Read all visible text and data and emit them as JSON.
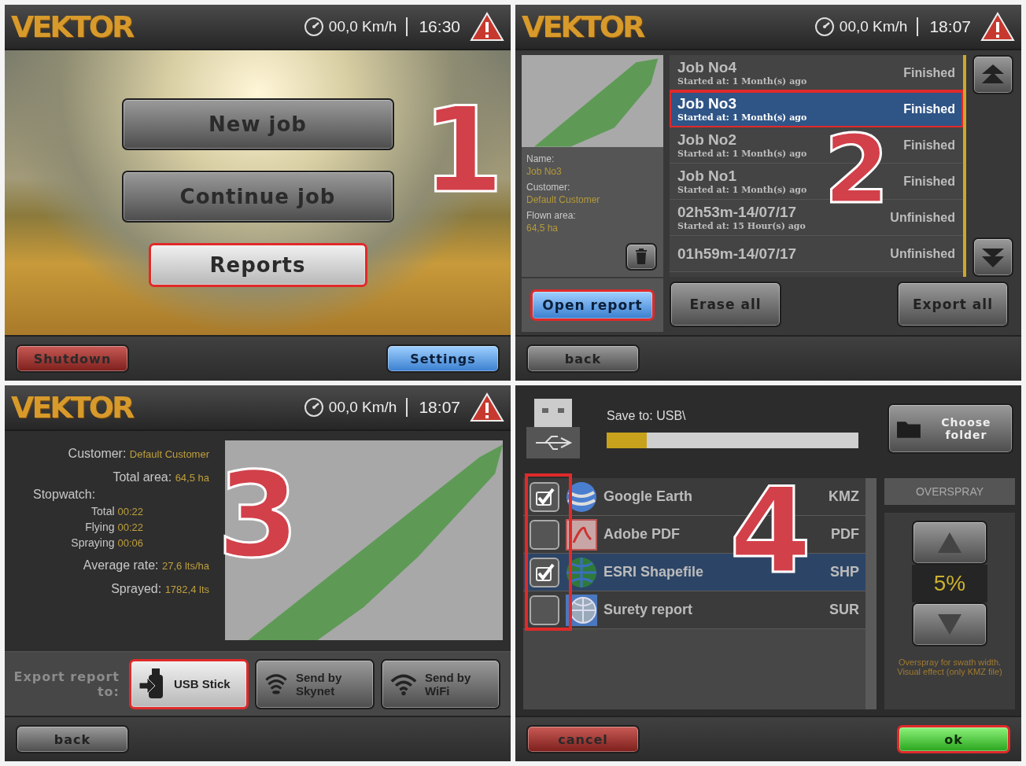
{
  "home": {
    "header": {
      "logo": "VEKTOR",
      "speed": "00,0 Km/h",
      "time": "16:30"
    },
    "step": "1",
    "buttons": [
      {
        "label": "New job",
        "highlighted": false
      },
      {
        "label": "Continue job",
        "highlighted": false
      },
      {
        "label": "Reports",
        "highlighted": true
      }
    ],
    "footer": [
      {
        "label": "Shutdown",
        "kind": "danger"
      },
      {
        "label": "Settings",
        "kind": "primary"
      }
    ]
  },
  "job_list": {
    "header": {
      "logo": "VEKTOR",
      "speed": "00,0 Km/h",
      "time": "18:07"
    },
    "step": "2",
    "details": [
      {
        "label": "Name:",
        "value": "Job No3"
      },
      {
        "label": "Customer:",
        "value": "Default Customer"
      },
      {
        "label": "Flown area:",
        "value": "64,5 ha"
      }
    ],
    "jobs": [
      {
        "name": "Job No4",
        "started": "Started at: 1 Month(s) ago",
        "status": "Finished",
        "selected": false,
        "highlighted": false
      },
      {
        "name": "Job No3",
        "started": "Started at: 1 Month(s) ago",
        "status": "Finished",
        "selected": true,
        "highlighted": true
      },
      {
        "name": "Job No2",
        "started": "Started at: 1 Month(s) ago",
        "status": "Finished",
        "selected": false,
        "highlighted": false
      },
      {
        "name": "Job No1",
        "started": "Started at: 1 Month(s) ago",
        "status": "Finished",
        "selected": false,
        "highlighted": false
      },
      {
        "name": "02h53m-14/07/17",
        "started": "Started at: 15 Hour(s) ago",
        "status": "Unfinished",
        "selected": false,
        "highlighted": false
      },
      {
        "name": "01h59m-14/07/17",
        "status": "Unfinished",
        "selected": false,
        "highlighted": false
      }
    ],
    "actions": [
      {
        "label": "Open report",
        "kind": "primary",
        "highlighted": true
      },
      {
        "label": "Erase all",
        "kind": "default",
        "highlighted": false
      },
      {
        "label": "Export all",
        "kind": "default",
        "highlighted": false
      }
    ],
    "footer": [
      {
        "label": "back",
        "kind": "default"
      }
    ]
  },
  "report": {
    "header": {
      "logo": "VEKTOR",
      "speed": "00,0 Km/h",
      "time": "18:07"
    },
    "step": "3",
    "summary": [
      {
        "kind": "main",
        "label": "Customer:",
        "value": "Default Customer"
      },
      {
        "kind": "main",
        "label": "Total area:",
        "value": "64,5 ha"
      },
      {
        "kind": "heading",
        "label": "Stopwatch:"
      },
      {
        "kind": "sub",
        "label": "Total",
        "value": "00:22"
      },
      {
        "kind": "sub",
        "label": "Flying",
        "value": "00:22"
      },
      {
        "kind": "sub",
        "label": "Spraying",
        "value": "00:06"
      },
      {
        "kind": "main",
        "label": "Average rate:",
        "value": "27,6 lts/ha"
      },
      {
        "kind": "main",
        "label": "Sprayed:",
        "value": "1782,4 lts"
      }
    ],
    "export_label": "Export report to:",
    "targets": [
      {
        "kind": "usb",
        "label": "USB Stick",
        "selected": true,
        "highlighted": true
      },
      {
        "kind": "skynet",
        "label": "Send by Skynet",
        "selected": false,
        "highlighted": false
      },
      {
        "kind": "wifi",
        "label": "Send by WiFi",
        "selected": false,
        "highlighted": false
      }
    ],
    "footer": [
      {
        "label": "back",
        "kind": "default"
      }
    ]
  },
  "export": {
    "step": "4",
    "save_to": "Save to: USB\\",
    "progress": {
      "level": 0.16
    },
    "choose_folder": "Choose folder",
    "checkboxes_highlighted": true,
    "formats": [
      {
        "kind": "globe",
        "name": "Google Earth",
        "ext": "KMZ",
        "checked": true,
        "selected": false
      },
      {
        "kind": "pdf",
        "name": "Adobe PDF",
        "ext": "PDF",
        "checked": false,
        "selected": false
      },
      {
        "kind": "shapefile",
        "name": "ESRI Shapefile",
        "ext": "SHP",
        "checked": true,
        "selected": true
      },
      {
        "kind": "survey",
        "name": "Surety report",
        "ext": "SUR",
        "checked": false,
        "selected": false
      }
    ],
    "overspray": {
      "title": "OVERSPRAY",
      "value": "5%",
      "note": "Overspray for swath width. Visual effect (only KMZ file)"
    },
    "footer": [
      {
        "label": "cancel",
        "kind": "danger",
        "highlighted": false
      },
      {
        "label": "ok",
        "kind": "success",
        "highlighted": true
      }
    ]
  }
}
